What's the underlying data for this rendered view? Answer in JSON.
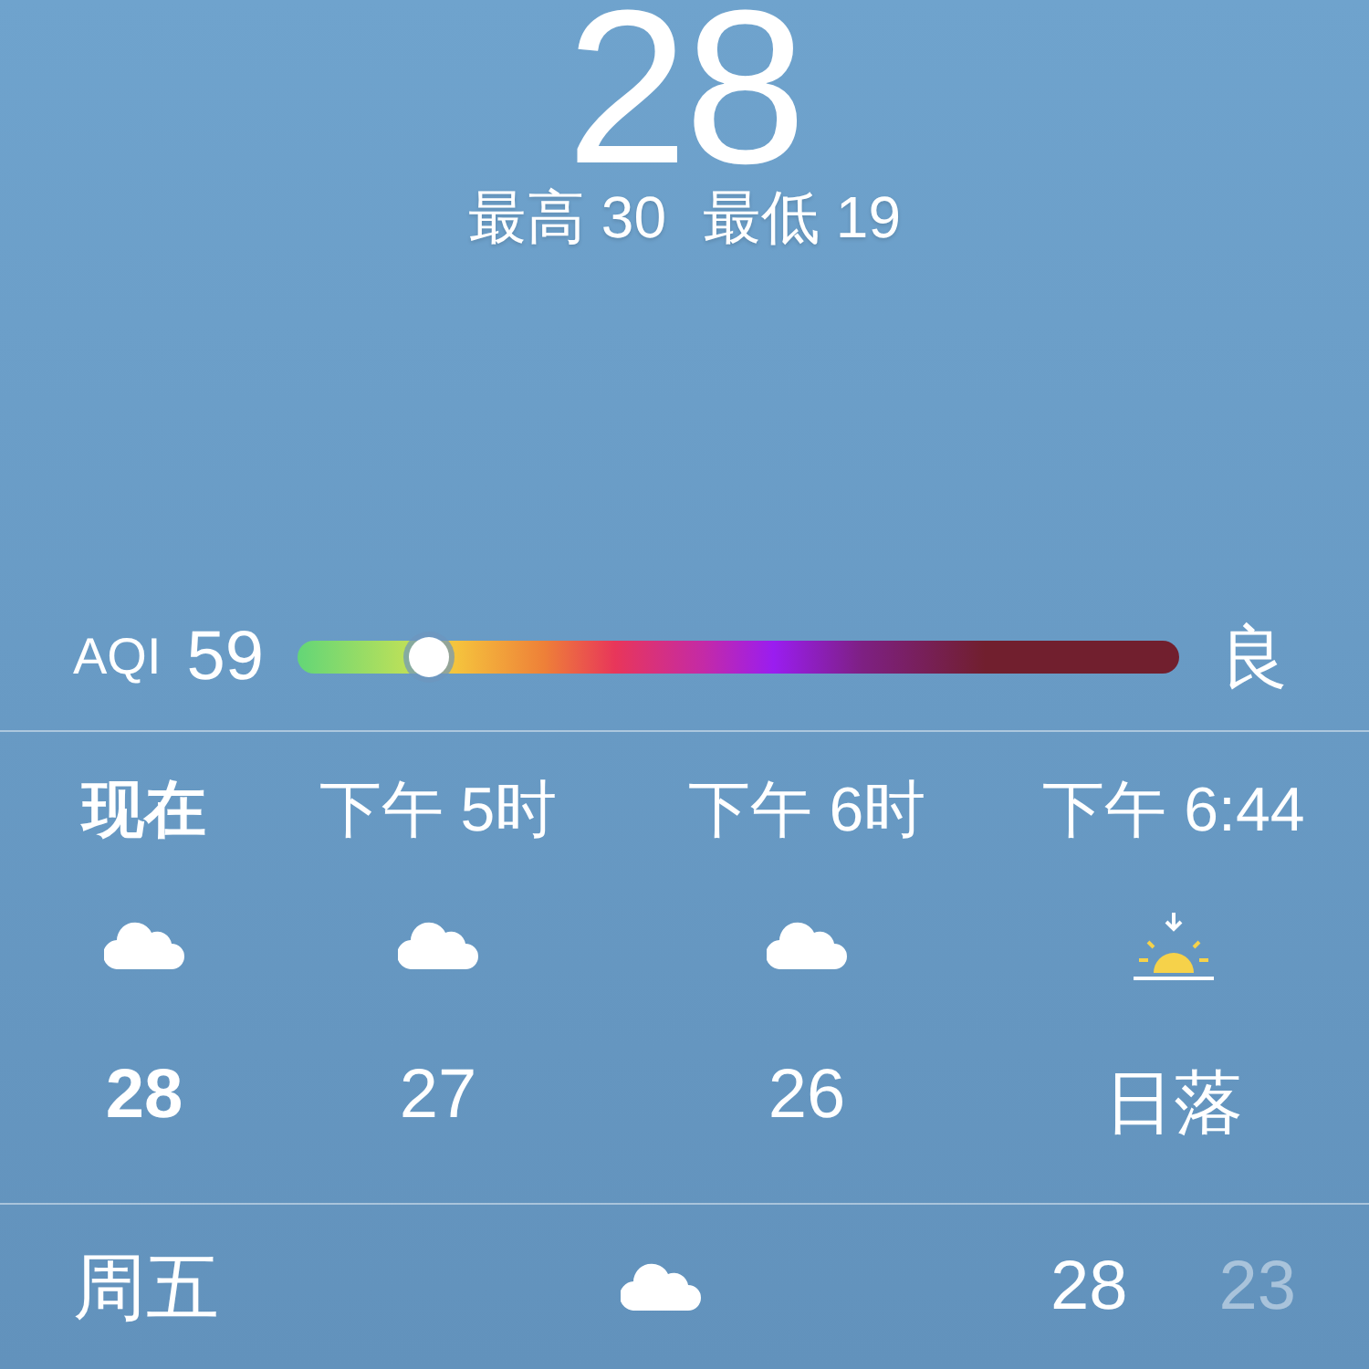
{
  "current": {
    "temperature": "28",
    "high": "最高 30",
    "low": "最低 19"
  },
  "aqi": {
    "label": "AQI",
    "value": "59",
    "level": 0.15,
    "quality": "良"
  },
  "hourly": [
    {
      "kind": "hour",
      "current": true,
      "time": "现在",
      "temp": "28"
    },
    {
      "kind": "hour",
      "current": false,
      "time": "下午 5时",
      "temp": "27"
    },
    {
      "kind": "hour",
      "current": false,
      "time": "下午 6时",
      "temp": "26"
    },
    {
      "kind": "sunset",
      "current": false,
      "time": "下午 6:44",
      "temp": "日落"
    }
  ],
  "daily": [
    {
      "day": "周五",
      "high": "28",
      "low": "23"
    }
  ]
}
